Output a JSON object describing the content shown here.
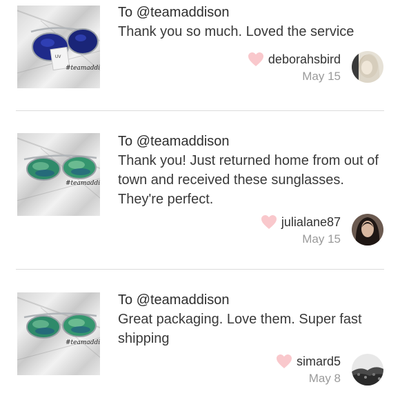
{
  "reviews": [
    {
      "to": "To @teamaddison",
      "message": "Thank you so much. Loved the service",
      "author": "deborahsbird",
      "date": "May 15",
      "image_tag": "#teamaddison",
      "lens_color": "#1f2a8a"
    },
    {
      "to": "To @teamaddison",
      "message": "Thank you! Just returned home from out of town and received these sunglasses. They're perfect.",
      "author": "julialane87",
      "date": "May 15",
      "image_tag": "#teamaddison",
      "lens_color": "#2f8a6a"
    },
    {
      "to": "To @teamaddison",
      "message": "Great packaging. Love them. Super fast shipping",
      "author": "simard5",
      "date": "May 8",
      "image_tag": "#teamaddison",
      "lens_color": "#2f8a6a"
    }
  ],
  "colors": {
    "heart": "#f9c8cc",
    "divider": "#dcdcdc",
    "date_text": "#9a9a9a"
  },
  "icons": {
    "like": "heart-icon"
  }
}
